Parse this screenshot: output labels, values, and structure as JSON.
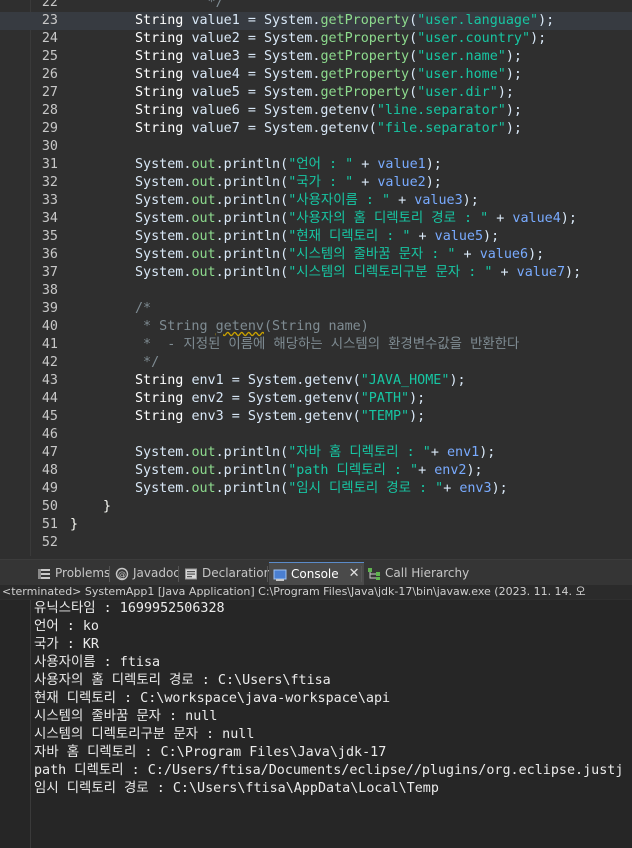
{
  "editor": {
    "lines": [
      {
        "n": "22",
        "tokens": [
          {
            "c": "t-cmt",
            "t": "         */"
          }
        ]
      },
      {
        "n": "23",
        "current": true,
        "tokens": [
          {
            "c": "t-type",
            "t": "String "
          },
          {
            "c": "t-ident",
            "t": "value1 = System."
          },
          {
            "c": "t-field",
            "t": "getProperty"
          },
          {
            "c": "t-ident",
            "t": "("
          },
          {
            "c": "t-str",
            "t": "\"user.language\""
          },
          {
            "c": "t-ident",
            "t": ");"
          }
        ]
      },
      {
        "n": "24",
        "tokens": [
          {
            "c": "t-type",
            "t": "String "
          },
          {
            "c": "t-ident",
            "t": "value2 = System."
          },
          {
            "c": "t-field",
            "t": "getProperty"
          },
          {
            "c": "t-ident",
            "t": "("
          },
          {
            "c": "t-str",
            "t": "\"user.country\""
          },
          {
            "c": "t-ident",
            "t": ");"
          }
        ]
      },
      {
        "n": "25",
        "tokens": [
          {
            "c": "t-type",
            "t": "String "
          },
          {
            "c": "t-ident",
            "t": "value3 = System."
          },
          {
            "c": "t-field",
            "t": "getProperty"
          },
          {
            "c": "t-ident",
            "t": "("
          },
          {
            "c": "t-str",
            "t": "\"user.name\""
          },
          {
            "c": "t-ident",
            "t": ");"
          }
        ]
      },
      {
        "n": "26",
        "tokens": [
          {
            "c": "t-type",
            "t": "String "
          },
          {
            "c": "t-ident",
            "t": "value4 = System."
          },
          {
            "c": "t-field",
            "t": "getProperty"
          },
          {
            "c": "t-ident",
            "t": "("
          },
          {
            "c": "t-str",
            "t": "\"user.home\""
          },
          {
            "c": "t-ident",
            "t": ");"
          }
        ]
      },
      {
        "n": "27",
        "tokens": [
          {
            "c": "t-type",
            "t": "String "
          },
          {
            "c": "t-ident",
            "t": "value5 = System."
          },
          {
            "c": "t-field",
            "t": "getProperty"
          },
          {
            "c": "t-ident",
            "t": "("
          },
          {
            "c": "t-str",
            "t": "\"user.dir\""
          },
          {
            "c": "t-ident",
            "t": ");"
          }
        ]
      },
      {
        "n": "28",
        "tokens": [
          {
            "c": "t-type",
            "t": "String "
          },
          {
            "c": "t-ident",
            "t": "value6 = System.getenv("
          },
          {
            "c": "t-str",
            "t": "\"line.separator\""
          },
          {
            "c": "t-ident",
            "t": ");"
          }
        ]
      },
      {
        "n": "29",
        "tokens": [
          {
            "c": "t-type",
            "t": "String "
          },
          {
            "c": "t-ident",
            "t": "value7 = System.getenv("
          },
          {
            "c": "t-str",
            "t": "\"file.separator\""
          },
          {
            "c": "t-ident",
            "t": ");"
          }
        ]
      },
      {
        "n": "30",
        "tokens": []
      },
      {
        "n": "31",
        "tokens": [
          {
            "c": "t-ident",
            "t": "System."
          },
          {
            "c": "t-field",
            "t": "out"
          },
          {
            "c": "t-ident",
            "t": ".println("
          },
          {
            "c": "t-str",
            "t": "\"언어 : \""
          },
          {
            "c": "t-ident",
            "t": " + "
          },
          {
            "c": "t-var",
            "t": "value1"
          },
          {
            "c": "t-ident",
            "t": ");"
          }
        ]
      },
      {
        "n": "32",
        "tokens": [
          {
            "c": "t-ident",
            "t": "System."
          },
          {
            "c": "t-field",
            "t": "out"
          },
          {
            "c": "t-ident",
            "t": ".println("
          },
          {
            "c": "t-str",
            "t": "\"국가 : \""
          },
          {
            "c": "t-ident",
            "t": " + "
          },
          {
            "c": "t-var",
            "t": "value2"
          },
          {
            "c": "t-ident",
            "t": ");"
          }
        ]
      },
      {
        "n": "33",
        "tokens": [
          {
            "c": "t-ident",
            "t": "System."
          },
          {
            "c": "t-field",
            "t": "out"
          },
          {
            "c": "t-ident",
            "t": ".println("
          },
          {
            "c": "t-str",
            "t": "\"사용자이름 : \""
          },
          {
            "c": "t-ident",
            "t": " + "
          },
          {
            "c": "t-var",
            "t": "value3"
          },
          {
            "c": "t-ident",
            "t": ");"
          }
        ]
      },
      {
        "n": "34",
        "tokens": [
          {
            "c": "t-ident",
            "t": "System."
          },
          {
            "c": "t-field",
            "t": "out"
          },
          {
            "c": "t-ident",
            "t": ".println("
          },
          {
            "c": "t-str",
            "t": "\"사용자의 홈 디렉토리 경로 : \""
          },
          {
            "c": "t-ident",
            "t": " + "
          },
          {
            "c": "t-var",
            "t": "value4"
          },
          {
            "c": "t-ident",
            "t": ");"
          }
        ]
      },
      {
        "n": "35",
        "tokens": [
          {
            "c": "t-ident",
            "t": "System."
          },
          {
            "c": "t-field",
            "t": "out"
          },
          {
            "c": "t-ident",
            "t": ".println("
          },
          {
            "c": "t-str",
            "t": "\"현재 디렉토리 : \""
          },
          {
            "c": "t-ident",
            "t": " + "
          },
          {
            "c": "t-var",
            "t": "value5"
          },
          {
            "c": "t-ident",
            "t": ");"
          }
        ]
      },
      {
        "n": "36",
        "tokens": [
          {
            "c": "t-ident",
            "t": "System."
          },
          {
            "c": "t-field",
            "t": "out"
          },
          {
            "c": "t-ident",
            "t": ".println("
          },
          {
            "c": "t-str",
            "t": "\"시스템의 줄바꿈 문자 : \""
          },
          {
            "c": "t-ident",
            "t": " + "
          },
          {
            "c": "t-var",
            "t": "value6"
          },
          {
            "c": "t-ident",
            "t": ");"
          }
        ]
      },
      {
        "n": "37",
        "tokens": [
          {
            "c": "t-ident",
            "t": "System."
          },
          {
            "c": "t-field",
            "t": "out"
          },
          {
            "c": "t-ident",
            "t": ".println("
          },
          {
            "c": "t-str",
            "t": "\"시스템의 디렉토리구분 문자 : \""
          },
          {
            "c": "t-ident",
            "t": " + "
          },
          {
            "c": "t-var",
            "t": "value7"
          },
          {
            "c": "t-ident",
            "t": ");"
          }
        ]
      },
      {
        "n": "38",
        "tokens": []
      },
      {
        "n": "39",
        "tokens": [
          {
            "c": "t-cmt",
            "t": "/*"
          }
        ]
      },
      {
        "n": "40",
        "tokens": [
          {
            "c": "t-cmt",
            "t": " * String "
          },
          {
            "c": "t-cmt-under",
            "t": "getenv"
          },
          {
            "c": "t-cmt",
            "t": "(String name)"
          }
        ]
      },
      {
        "n": "41",
        "tokens": [
          {
            "c": "t-cmt",
            "t": " *  - 지정된 이름에 해당하는 시스템의 환경변수값을 반환한다"
          }
        ]
      },
      {
        "n": "42",
        "tokens": [
          {
            "c": "t-cmt",
            "t": " */"
          }
        ]
      },
      {
        "n": "43",
        "tokens": [
          {
            "c": "t-type",
            "t": "String "
          },
          {
            "c": "t-ident",
            "t": "env1 = System.getenv("
          },
          {
            "c": "t-str",
            "t": "\"JAVA_HOME\""
          },
          {
            "c": "t-ident",
            "t": ");"
          }
        ]
      },
      {
        "n": "44",
        "tokens": [
          {
            "c": "t-type",
            "t": "String "
          },
          {
            "c": "t-ident",
            "t": "env2 = System.getenv("
          },
          {
            "c": "t-str",
            "t": "\"PATH\""
          },
          {
            "c": "t-ident",
            "t": ");"
          }
        ]
      },
      {
        "n": "45",
        "tokens": [
          {
            "c": "t-type",
            "t": "String "
          },
          {
            "c": "t-ident",
            "t": "env3 = System.getenv("
          },
          {
            "c": "t-str",
            "t": "\"TEMP\""
          },
          {
            "c": "t-ident",
            "t": ");"
          }
        ]
      },
      {
        "n": "46",
        "tokens": []
      },
      {
        "n": "47",
        "tokens": [
          {
            "c": "t-ident",
            "t": "System."
          },
          {
            "c": "t-field",
            "t": "out"
          },
          {
            "c": "t-ident",
            "t": ".println("
          },
          {
            "c": "t-str",
            "t": "\"자바 홈 디렉토리 : \""
          },
          {
            "c": "t-ident",
            "t": "+ "
          },
          {
            "c": "t-var",
            "t": "env1"
          },
          {
            "c": "t-ident",
            "t": ");"
          }
        ]
      },
      {
        "n": "48",
        "tokens": [
          {
            "c": "t-ident",
            "t": "System."
          },
          {
            "c": "t-field",
            "t": "out"
          },
          {
            "c": "t-ident",
            "t": ".println("
          },
          {
            "c": "t-str",
            "t": "\"path 디렉토리 : \""
          },
          {
            "c": "t-ident",
            "t": "+ "
          },
          {
            "c": "t-var",
            "t": "env2"
          },
          {
            "c": "t-ident",
            "t": ");"
          }
        ]
      },
      {
        "n": "49",
        "tokens": [
          {
            "c": "t-ident",
            "t": "System."
          },
          {
            "c": "t-field",
            "t": "out"
          },
          {
            "c": "t-ident",
            "t": ".println("
          },
          {
            "c": "t-str",
            "t": "\"임시 디렉토리 경로 : \""
          },
          {
            "c": "t-ident",
            "t": "+ "
          },
          {
            "c": "t-var",
            "t": "env3"
          },
          {
            "c": "t-ident",
            "t": ");"
          }
        ]
      },
      {
        "n": "50",
        "indent": "brace1",
        "tokens": [
          {
            "c": "t-brace",
            "t": "}"
          }
        ]
      },
      {
        "n": "51",
        "indent": "brace0",
        "tokens": [
          {
            "c": "t-brace",
            "t": "}"
          }
        ]
      },
      {
        "n": "52",
        "tokens": []
      }
    ]
  },
  "views": {
    "tabs": [
      {
        "name": "tab-problems",
        "icon": "problems-icon",
        "label": "Problems",
        "active": false
      },
      {
        "name": "tab-javadoc",
        "icon": "javadoc-icon",
        "label": "Javadoc",
        "active": false
      },
      {
        "name": "tab-declaration",
        "icon": "declaration-icon",
        "label": "Declaration",
        "active": false
      },
      {
        "name": "tab-console",
        "icon": "console-icon",
        "label": "Console",
        "active": true,
        "close": "✕"
      },
      {
        "name": "tab-call-hierarchy",
        "icon": "call-hierarchy-icon",
        "label": "Call Hierarchy",
        "active": false
      }
    ]
  },
  "console": {
    "header": "<terminated> SystemApp1 [Java Application] C:\\Program Files\\Java\\jdk-17\\bin\\javaw.exe  (2023. 11. 14. 오",
    "output": [
      "유닉스타임 : 1699952506328",
      "언어 : ko",
      "국가 : KR",
      "사용자이름 : ftisa",
      "사용자의 홈 디렉토리 경로 : C:\\Users\\ftisa",
      "현재 디렉토리 : C:\\workspace\\java-workspace\\api",
      "시스템의 줄바꿈 문자 : null",
      "시스템의 디렉토리구분 문자 : null",
      "자바 홈 디렉토리 : C:\\Program Files\\Java\\jdk-17",
      "path 디렉토리 : C:/Users/ftisa/Documents/eclipse//plugins/org.eclipse.justj",
      "임시 디렉토리 경로 : C:\\Users\\ftisa\\AppData\\Local\\Temp"
    ]
  },
  "colors": {
    "editor_bg": "#2f2f2f",
    "console_bg": "#262626",
    "string": "#17c6a3",
    "field": "#8dda8d",
    "variable": "#79abff",
    "comment": "#7f8c93"
  }
}
